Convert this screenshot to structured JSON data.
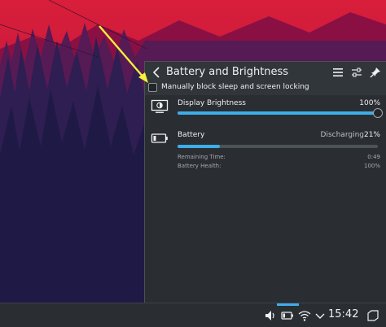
{
  "popup": {
    "title": "Battery and Brightness",
    "inhibit_checkbox": {
      "label": "Manually block sleep and screen locking",
      "checked": false
    },
    "header_icons": [
      "hamburger-menu-icon",
      "configure-icon",
      "pin-icon"
    ],
    "brightness": {
      "label": "Display Brightness",
      "value_text": "100%",
      "level": 1.0,
      "icon": "monitor-brightness-icon"
    },
    "battery": {
      "label": "Battery",
      "status": "Discharging",
      "percent_text": "21%",
      "level": 0.21,
      "icon": "battery-icon",
      "remaining_label": "Remaining Time:",
      "remaining_value": "0:49",
      "health_label": "Battery Health:",
      "health_value": "100%"
    }
  },
  "taskbar": {
    "clock": "15:42",
    "tray_icons": [
      "volume-icon",
      "battery-tray-icon",
      "wifi-icon",
      "expand-tray-icon",
      "show-desktop-icon"
    ]
  },
  "colors": {
    "accent": "#3daee9",
    "panel": "#31363b",
    "wallpaper_sky": "#c2183c",
    "arrow": "#f4f03b"
  }
}
